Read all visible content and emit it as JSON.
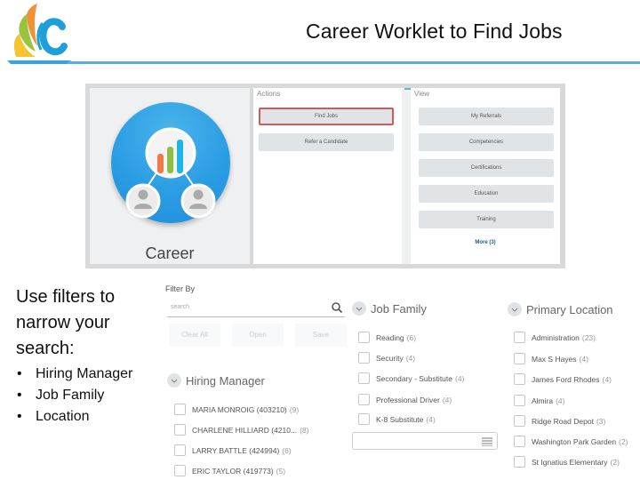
{
  "header": {
    "title": "Career Worklet to Find Jobs",
    "logo": "district-logo-icon",
    "rule_color": "#5aaee0"
  },
  "workday": {
    "worklet": {
      "label": "Career",
      "icon": "career-org-chart-icon",
      "circle_color": "#2b9de3"
    },
    "actions": {
      "heading": "Actions",
      "buttons": [
        {
          "label": "Find Jobs",
          "selected": true
        },
        {
          "label": "Refer a Candidate",
          "selected": false
        }
      ]
    },
    "view": {
      "heading": "View",
      "buttons": [
        {
          "label": "My Referrals"
        },
        {
          "label": "Competencies"
        },
        {
          "label": "Certifications"
        },
        {
          "label": "Education"
        },
        {
          "label": "Training"
        }
      ],
      "more_link": "More (3)"
    },
    "selected_border_color": "#d05a5a"
  },
  "instructions": {
    "lines": [
      "Use filters to",
      "narrow your",
      "search:"
    ],
    "bullets": [
      "Hiring Manager",
      "Job Family",
      "Location"
    ]
  },
  "filters": {
    "heading": "Filter By",
    "search_placeholder": "search",
    "buttons": [
      "Clear All",
      "Open",
      "Save"
    ],
    "hiring_manager": {
      "title": "Hiring Manager",
      "items": [
        {
          "label": "MARIA MONROIG (403210)",
          "count": "(9)"
        },
        {
          "label": "CHARLENE HILLIARD (4210...",
          "count": "(8)"
        },
        {
          "label": "LARRY BATTLE (424994)",
          "count": "(6)"
        },
        {
          "label": "ERIC TAYLOR (419773)",
          "count": "(5)"
        }
      ]
    },
    "job_family": {
      "title": "Job Family",
      "items": [
        {
          "label": "Reading",
          "count": "(6)"
        },
        {
          "label": "Security",
          "count": "(4)"
        },
        {
          "label": "Secondary - Substitute",
          "count": "(4)"
        },
        {
          "label": "Professional Driver",
          "count": "(4)"
        },
        {
          "label": "K-8 Substitute",
          "count": "(4)"
        }
      ]
    },
    "primary_location": {
      "title": "Primary Location",
      "items": [
        {
          "label": "Administration",
          "count": "(23)"
        },
        {
          "label": "Max S Hayes",
          "count": "(4)"
        },
        {
          "label": "James Ford Rhodes",
          "count": "(4)"
        },
        {
          "label": "Almira",
          "count": "(4)"
        },
        {
          "label": "Ridge Road Depot",
          "count": "(3)"
        },
        {
          "label": "Washington Park Garden",
          "count": "(2)"
        },
        {
          "label": "St Ignatius Elementary",
          "count": "(2)"
        }
      ]
    }
  }
}
